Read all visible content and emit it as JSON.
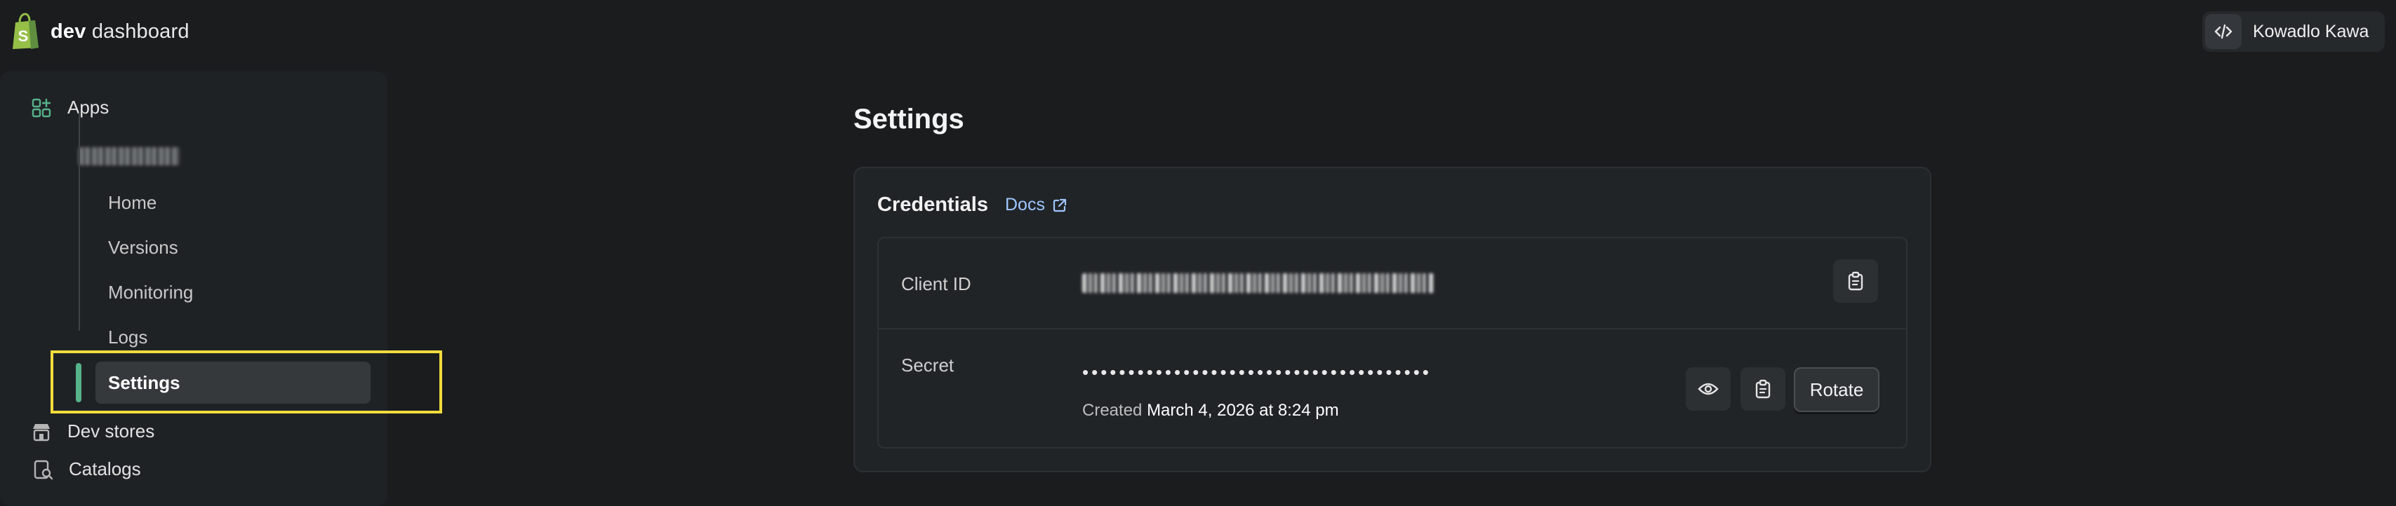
{
  "brand": {
    "bold": "dev",
    "rest": " dashboard",
    "accent": "#56b38a"
  },
  "user": {
    "name": "Kowadlo Kawa",
    "icon": "code-icon"
  },
  "sidebar": {
    "apps_label": "Apps",
    "app_name": "",
    "sub_items": [
      {
        "label": "Home"
      },
      {
        "label": "Versions"
      },
      {
        "label": "Monitoring"
      },
      {
        "label": "Logs"
      },
      {
        "label": "Settings",
        "active": true
      }
    ],
    "dev_stores_label": "Dev stores",
    "catalogs_label": "Catalogs",
    "highlight_color": "#f2dc3d"
  },
  "page": {
    "title": "Settings"
  },
  "credentials": {
    "title": "Credentials",
    "docs_label": "Docs",
    "client_id_label": "Client ID",
    "secret_label": "Secret",
    "secret_mask": "••••••••••••••••••••••••••••••••••••••",
    "created_label": "Created",
    "created_value": "March 4, 2026 at 8:24 pm",
    "rotate_label": "Rotate"
  }
}
